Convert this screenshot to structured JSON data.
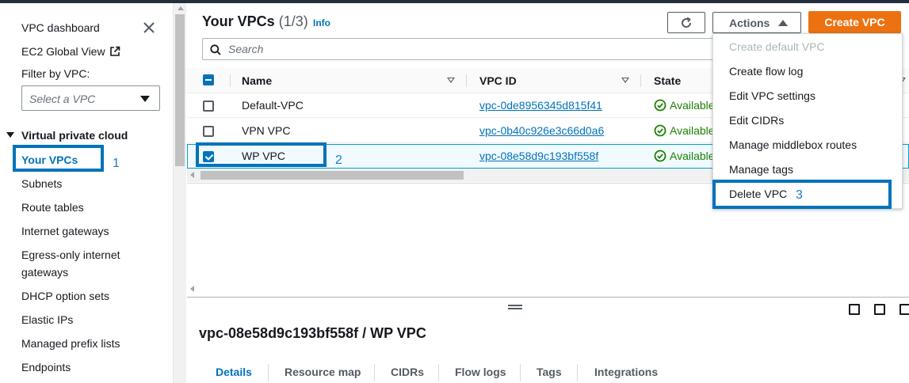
{
  "sidebar": {
    "dashboard": "VPC dashboard",
    "ec2_global_view": "EC2 Global View",
    "filter_label": "Filter by VPC:",
    "filter_placeholder": "Select a VPC",
    "section": "Virtual private cloud",
    "items": [
      {
        "label": "Your VPCs",
        "active": true
      },
      {
        "label": "Subnets"
      },
      {
        "label": "Route tables"
      },
      {
        "label": "Internet gateways"
      },
      {
        "label": "Egress-only internet"
      },
      {
        "label": "gateways"
      },
      {
        "label": "DHCP option sets"
      },
      {
        "label": "Elastic IPs"
      },
      {
        "label": "Managed prefix lists"
      },
      {
        "label": "Endpoints"
      }
    ]
  },
  "header": {
    "title": "Your VPCs",
    "count": "(1/3)",
    "info": "Info",
    "actions_label": "Actions",
    "create_label": "Create VPC"
  },
  "search": {
    "placeholder": "Search"
  },
  "table": {
    "columns": [
      "Name",
      "VPC ID",
      "State"
    ],
    "rows": [
      {
        "name": "Default-VPC",
        "vpc_id": "vpc-0de8956345d815f41",
        "state": "Available",
        "selected": false
      },
      {
        "name": "VPN VPC",
        "vpc_id": "vpc-0b40c926e3c66d0a6",
        "state": "Available",
        "selected": false
      },
      {
        "name": "WP VPC",
        "vpc_id": "vpc-08e58d9c193bf558f",
        "state": "Available",
        "selected": true
      }
    ]
  },
  "actions_menu": [
    {
      "label": "Create default VPC",
      "disabled": true
    },
    {
      "label": "Create flow log"
    },
    {
      "label": "Edit VPC settings"
    },
    {
      "label": "Edit CIDRs"
    },
    {
      "label": "Manage middlebox routes"
    },
    {
      "label": "Manage tags"
    },
    {
      "label": "Delete VPC"
    }
  ],
  "details": {
    "title": "vpc-08e58d9c193bf558f / WP VPC",
    "tabs": [
      "Details",
      "Resource map",
      "CIDRs",
      "Flow logs",
      "Tags",
      "Integrations"
    ],
    "active_tab": "Details"
  },
  "annotations": [
    "1",
    "2",
    "3"
  ],
  "colors": {
    "accent": "#0073bb",
    "primary_button": "#ec7211",
    "status_ok": "#1d8102",
    "annotation": "#0073bb"
  }
}
